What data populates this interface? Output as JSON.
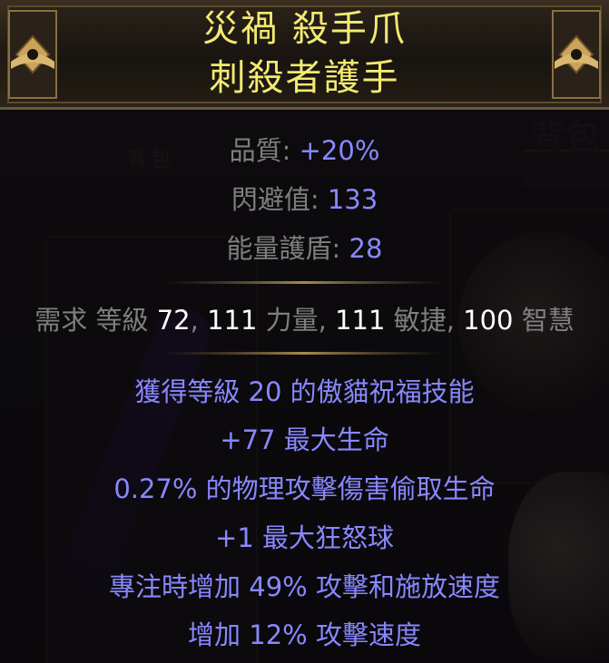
{
  "item": {
    "name": "災禍 殺手爪",
    "base": "刺殺者護手",
    "properties": [
      {
        "label": "品質",
        "value": "+20%"
      },
      {
        "label": "閃避值",
        "value": "133"
      },
      {
        "label": "能量護盾",
        "value": "28"
      }
    ],
    "requirements": {
      "prefix": "需求",
      "level_label": "等級",
      "level": "72",
      "str": "111",
      "str_label": "力量",
      "dex": "111",
      "dex_label": "敏捷",
      "int": "100",
      "int_label": "智慧"
    },
    "mods": [
      "獲得等級 20 的傲貓祝福技能",
      "+77 最大生命",
      "0.27% 的物理攻擊傷害偷取生命",
      "+1 最大狂怒球",
      "專注時增加 49% 攻擊和施放速度",
      "增加 12% 攻擊速度"
    ]
  },
  "background": {
    "bag_title": "背包",
    "bag_tab": "背包"
  },
  "colors": {
    "title": "#f3ea72",
    "property_label": "#7f7f7f",
    "property_value": "#8888ff",
    "requirement_value": "#ffffff",
    "mod": "#8888ff",
    "header_border": "#6b5a38"
  },
  "icons": [
    "left-header-ornament-icon",
    "right-header-ornament-icon"
  ]
}
